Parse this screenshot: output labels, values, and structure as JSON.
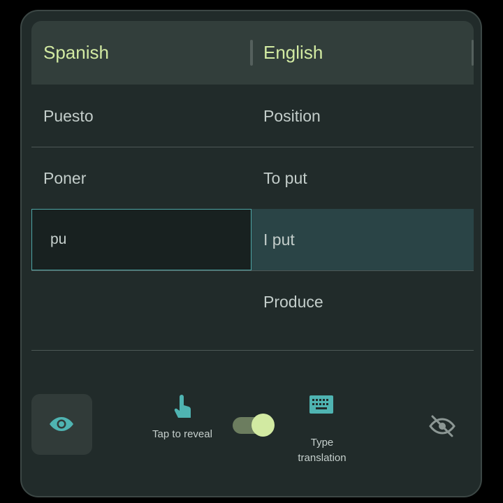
{
  "header": {
    "source_language": "Spanish",
    "target_language": "English"
  },
  "rows": [
    {
      "source": "Puesto",
      "target": "Position"
    },
    {
      "source": "Poner",
      "target": "To put"
    },
    {
      "source_input_value": "pu",
      "target": "I put"
    },
    {
      "source": "",
      "target": "Produce"
    }
  ],
  "toolbar": {
    "show_icon": "eye-icon",
    "tap_icon": "tap-finger-icon",
    "tap_label": "Tap to reveal",
    "toggle_on": true,
    "type_icon": "keyboard-icon",
    "type_label_line1": "Type",
    "type_label_line2": "translation",
    "hide_icon": "eye-off-icon"
  },
  "colors": {
    "accent": "#d2eaa2",
    "teal": "#4ea5a5",
    "background": "#212b2a",
    "highlight": "#2a4446"
  }
}
